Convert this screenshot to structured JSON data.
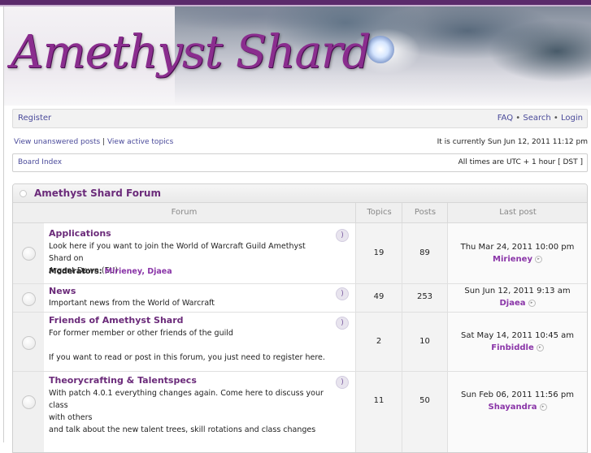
{
  "brand": {
    "logo_text": "Amethyst Shard"
  },
  "nav": {
    "register": "Register",
    "faq": "FAQ",
    "search": "Search",
    "login": "Login",
    "sep": "•"
  },
  "search_links": {
    "unanswered": "View unanswered posts",
    "pipe": "|",
    "active": "View active topics"
  },
  "status": {
    "current_time": "It is currently Sun Jun 12, 2011 11:12 pm",
    "timezone": "All times are UTC + 1 hour [ DST ]"
  },
  "breadcrumb": {
    "board_index": "Board Index"
  },
  "category": {
    "title": "Amethyst Shard Forum",
    "columns": {
      "forum": "Forum",
      "topics": "Topics",
      "posts": "Posts",
      "last_post": "Last post"
    },
    "forums": [
      {
        "name": "Applications",
        "desc1": "Look here if you want to join the World of Warcraft Guild Amethyst Shard on",
        "desc2": "Argent Dawn (EU)",
        "moderators_label": "Moderators:",
        "moderators": "Mirieney, Djaea",
        "topics": "19",
        "posts": "89",
        "last_date": "Thu Mar 24, 2011 10:00 pm",
        "last_user": "Mirieney"
      },
      {
        "name": "News",
        "desc1": "Important news from the World of Warcraft",
        "topics": "49",
        "posts": "253",
        "last_date": "Sun Jun 12, 2011 9:13 am",
        "last_user": "Djaea"
      },
      {
        "name": "Friends of Amethyst Shard",
        "desc1": "For former member or other friends of the guild",
        "desc2": "If you want to read or post in this forum, you just need to register here.",
        "topics": "2",
        "posts": "10",
        "last_date": "Sat May 14, 2011 10:45 am",
        "last_user": "Finbiddle"
      },
      {
        "name": "Theorycrafting & Talentspecs",
        "desc1": "With patch 4.0.1 everything changes again. Come here to discuss your class",
        "desc2": "with others",
        "desc3": "and talk about the new talent trees, skill rotations and class changes",
        "topics": "11",
        "posts": "50",
        "last_date": "Sun Feb 06, 2011 11:56 pm",
        "last_user": "Shayandra"
      }
    ]
  },
  "icons": {
    "forum_status": "forum-read-icon",
    "feed": "rss-feed-icon",
    "goto": "goto-last-post-icon"
  }
}
